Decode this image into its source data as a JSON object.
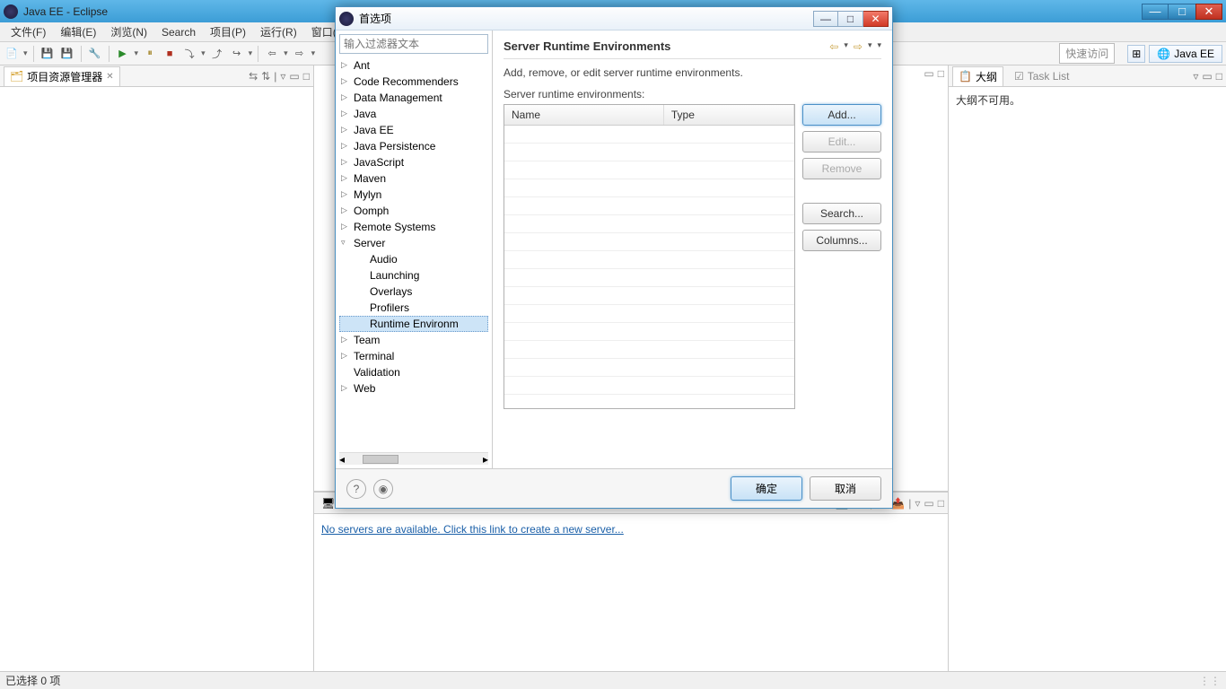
{
  "window": {
    "title": "Java EE - Eclipse"
  },
  "menu": {
    "file": "文件(F)",
    "edit": "编辑(E)",
    "navigate": "浏览(N)",
    "search": "Search",
    "project": "项目(P)",
    "run": "运行(R)",
    "window": "窗口(W"
  },
  "toolbar": {
    "quick_access": "快速访问",
    "perspective": "Java EE"
  },
  "left_view": {
    "tab_title": "项目资源管理器"
  },
  "right_view": {
    "tab_outline": "大纲",
    "tab_tasklist": "Task List",
    "body_text": "大纲不可用。"
  },
  "bottom_view": {
    "link_text": "No servers are available. Click this link to create a new server..."
  },
  "statusbar": {
    "text": "已选择 0 项"
  },
  "dialog": {
    "title": "首选项",
    "filter_placeholder": "输入过滤器文本",
    "tree": {
      "ant": "Ant",
      "code_rec": "Code Recommenders",
      "data_mgmt": "Data Management",
      "java": "Java",
      "javaee": "Java EE",
      "java_persist": "Java Persistence",
      "javascript": "JavaScript",
      "maven": "Maven",
      "mylyn": "Mylyn",
      "oomph": "Oomph",
      "remote": "Remote Systems",
      "server": "Server",
      "audio": "Audio",
      "launching": "Launching",
      "overlays": "Overlays",
      "profilers": "Profilers",
      "runtime_env": "Runtime Environm",
      "team": "Team",
      "terminal": "Terminal",
      "validation": "Validation",
      "web": "Web"
    },
    "page": {
      "heading": "Server Runtime Environments",
      "description": "Add, remove, or edit server runtime environments.",
      "sublabel": "Server runtime environments:",
      "col_name": "Name",
      "col_type": "Type",
      "btn_add": "Add...",
      "btn_edit": "Edit...",
      "btn_remove": "Remove",
      "btn_search": "Search...",
      "btn_columns": "Columns..."
    },
    "footer": {
      "ok": "确定",
      "cancel": "取消"
    }
  }
}
